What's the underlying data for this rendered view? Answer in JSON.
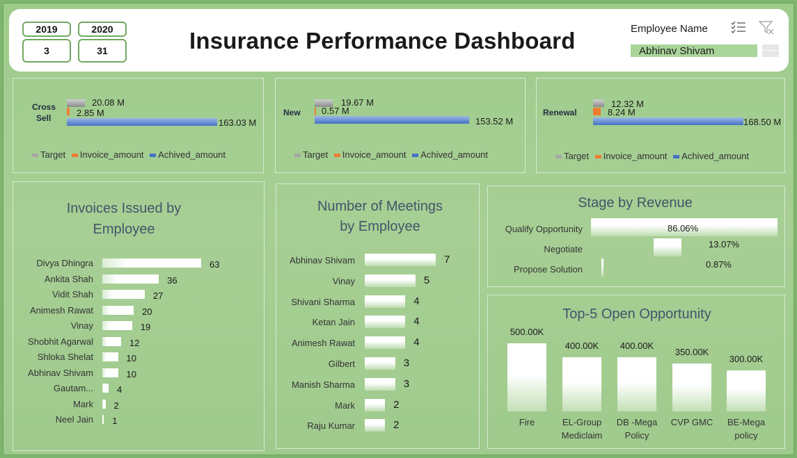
{
  "header": {
    "title": "Insurance Performance Dashboard",
    "year1": "2019",
    "year2": "2020",
    "count1": "3",
    "count2": "31",
    "employee_label": "Employee Name",
    "employee_value": "Abhinav Shivam"
  },
  "kpis": [
    {
      "label": "Cross Sell",
      "label_line1": "Cross",
      "label_line2": "Sell",
      "target": "20.08 M",
      "invoice": "2.85 M",
      "achieved": "163.03 M"
    },
    {
      "label": "New",
      "target": "19.67 M",
      "invoice": "0.57 M",
      "achieved": "153.52 M"
    },
    {
      "label": "Renewal",
      "target": "12.32 M",
      "invoice": "8.24 M",
      "achieved": "168.50 M"
    }
  ],
  "legend": {
    "target": "Target",
    "invoice": "Invoice_amount",
    "achieved": "Achived_amount"
  },
  "colors": {
    "target": "#a6a6a6",
    "invoice": "#ed7d31",
    "achieved": "#4472c4",
    "background": "#a7cf95"
  },
  "invoices": {
    "title_line1": "Invoices Issued by",
    "title_line2": "Employee",
    "rows": [
      {
        "name": "Divya Dhingra",
        "value": "63",
        "v": 63
      },
      {
        "name": "Ankita Shah",
        "value": "36",
        "v": 36
      },
      {
        "name": "Vidit Shah",
        "value": "27",
        "v": 27
      },
      {
        "name": "Animesh Rawat",
        "value": "20",
        "v": 20
      },
      {
        "name": "Vinay",
        "value": "19",
        "v": 19
      },
      {
        "name": "Shobhit Agarwal",
        "value": "12",
        "v": 12
      },
      {
        "name": "Shloka Shelat",
        "value": "10",
        "v": 10
      },
      {
        "name": "Abhinav Shivam",
        "value": "10",
        "v": 10
      },
      {
        "name": "Gautam...",
        "value": "4",
        "v": 4
      },
      {
        "name": "Mark",
        "value": "2",
        "v": 2
      },
      {
        "name": "Neel Jain",
        "value": "1",
        "v": 1
      }
    ]
  },
  "meetings": {
    "title_line1": "Number of Meetings",
    "title_line2": "by Employee",
    "rows": [
      {
        "name": "Abhinav Shivam",
        "value": "7",
        "v": 7
      },
      {
        "name": "Vinay",
        "value": "5",
        "v": 5
      },
      {
        "name": "Shivani Sharma",
        "value": "4",
        "v": 4
      },
      {
        "name": "Ketan Jain",
        "value": "4",
        "v": 4
      },
      {
        "name": "Animesh Rawat",
        "value": "4",
        "v": 4
      },
      {
        "name": "Gilbert",
        "value": "3",
        "v": 3
      },
      {
        "name": "Manish Sharma",
        "value": "3",
        "v": 3
      },
      {
        "name": "Mark",
        "value": "2",
        "v": 2
      },
      {
        "name": "Raju Kumar",
        "value": "2",
        "v": 2
      }
    ]
  },
  "stage": {
    "title": "Stage by Revenue",
    "rows": [
      {
        "name": "Qualify Opportunity",
        "value": "86.06%",
        "v": 86.06
      },
      {
        "name": "Negotiate",
        "value": "13.07%",
        "v": 13.07
      },
      {
        "name": "Propose Solution",
        "value": "0.87%",
        "v": 0.87
      }
    ]
  },
  "top5": {
    "title": "Top-5 Open Opportunity",
    "bars": [
      {
        "name_line1": "Fire",
        "name_line2": "",
        "value": "500.00K",
        "v": 500
      },
      {
        "name_line1": "EL-Group",
        "name_line2": "Mediclaim",
        "value": "400.00K",
        "v": 400
      },
      {
        "name_line1": "DB -Mega",
        "name_line2": "Policy",
        "value": "400.00K",
        "v": 400
      },
      {
        "name_line1": "CVP GMC",
        "name_line2": "",
        "value": "350.00K",
        "v": 350
      },
      {
        "name_line1": "BE-Mega",
        "name_line2": "policy",
        "value": "300.00K",
        "v": 300
      }
    ]
  }
}
